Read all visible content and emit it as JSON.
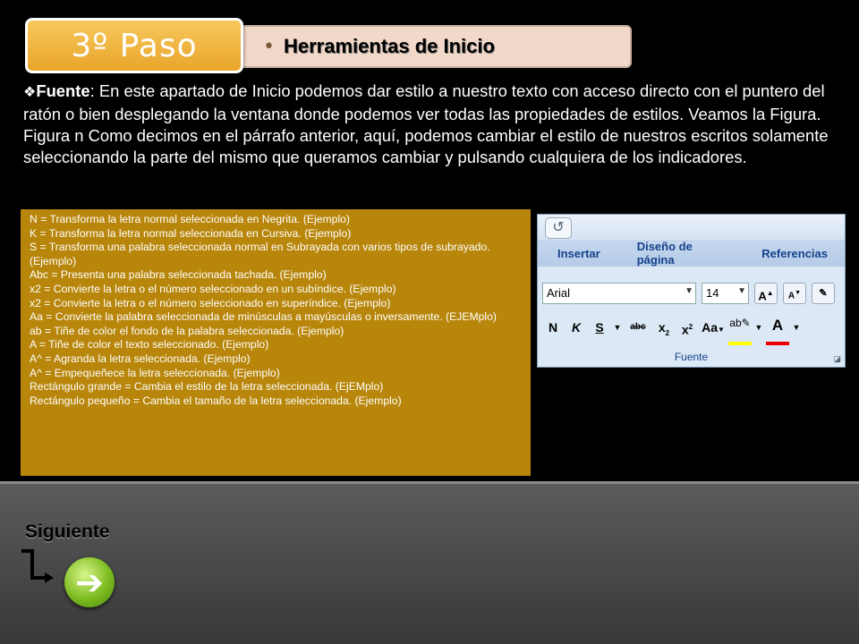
{
  "step": {
    "label": "3º  Paso"
  },
  "header": {
    "bullet": "•",
    "title": "Herramientas de Inicio"
  },
  "paragraph": {
    "star": "❖",
    "label": "Fuente",
    "text": ": En este apartado de Inicio podemos dar estilo a nuestro texto con acceso directo con el puntero del ratón o bien desplegando la ventana donde podemos ver todas las propiedades de estilos. Veamos la Figura. Figura n Como decimos en el párrafo anterior, aquí, podemos cambiar el estilo de nuestros escritos solamente seleccionando la parte del mismo que queramos cambiar  y pulsando cualquiera de los indicadores."
  },
  "info_lines": [
    "N = Transforma la letra normal seleccionada en Negrita. (Ejemplo)",
    "K = Transforma la letra normal seleccionada en Cursiva. (Ejemplo)",
    "S = Transforma una palabra seleccionada normal en Subrayada con varios tipos de subrayado. (Ejemplo)",
    "Abc = Presenta una palabra seleccionada tachada. (Ejemplo)",
    "x2 = Convierte la letra o el número seleccionado en un subíndice. (Ejemplo)",
    "x2 = Convierte la letra o el número seleccionado en superíndice. (Ejemplo)",
    "Aa = Convierte la palabra seleccionada de minúsculas a mayúsculas o inversamente. (EJEMplo)",
    "ab = Tiñe de color el fondo de la palabra seleccionada. (Ejemplo)",
    "A = Tiñe de color el texto seleccionado. (Ejemplo)",
    "A^ = Agranda la letra seleccionada. (Ejemplo)",
    "A^ = Empequeñece la letra seleccionada. (Ejemplo)",
    "Rectángulo grande = Cambia el estilo de la letra seleccionada. (EjEMplo)",
    "Rectángulo pequeño = Cambia el tamaño de la letra seleccionada. (Ejemplo)"
  ],
  "ribbon": {
    "tabs": [
      "Insertar",
      "Diseño de página",
      "Referencias"
    ],
    "font_name": "Arial",
    "font_size": "14",
    "group_label": "Fuente",
    "colors": {
      "highlight": "#ffff00",
      "font_color": "#e00000"
    }
  },
  "footer": {
    "next_label": "Siguiente"
  }
}
